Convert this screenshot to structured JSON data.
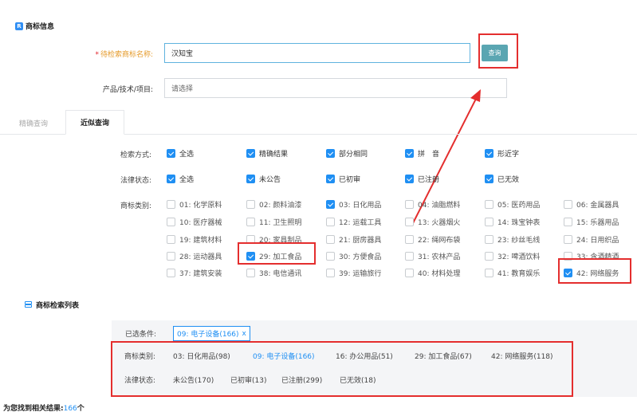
{
  "header": {
    "logo_letter": "R",
    "title": "商标信息"
  },
  "form": {
    "name_label": "待检索商标名称:",
    "name_value": "汉知宝",
    "query_button": "查询",
    "product_label": "产品/技术/项目:",
    "product_placeholder": "请选择"
  },
  "tabs": [
    {
      "label": "精确查询",
      "active": false
    },
    {
      "label": "近似查询",
      "active": true
    }
  ],
  "filters": {
    "method_label": "检索方式:",
    "method_options": [
      {
        "label": "全选",
        "checked": true
      },
      {
        "label": "精确结果",
        "checked": true
      },
      {
        "label": "部分相同",
        "checked": true
      },
      {
        "label": "拼　音",
        "checked": true
      },
      {
        "label": "形近字",
        "checked": true
      }
    ],
    "status_label": "法律状态:",
    "status_options": [
      {
        "label": "全选",
        "checked": true
      },
      {
        "label": "未公告",
        "checked": true
      },
      {
        "label": "已初审",
        "checked": true
      },
      {
        "label": "已注册",
        "checked": true
      },
      {
        "label": "已无效",
        "checked": true
      }
    ],
    "category_label": "商标类别:",
    "categories": [
      {
        "label": "01: 化学原料",
        "checked": false
      },
      {
        "label": "02: 颜料油漆",
        "checked": false
      },
      {
        "label": "03: 日化用品",
        "checked": true
      },
      {
        "label": "04: 油脂燃料",
        "checked": false
      },
      {
        "label": "05: 医药用品",
        "checked": false
      },
      {
        "label": "06: 金属器具",
        "checked": false
      },
      {
        "label": "10: 医疗器械",
        "checked": false
      },
      {
        "label": "11: 卫生照明",
        "checked": false
      },
      {
        "label": "12: 运载工具",
        "checked": false
      },
      {
        "label": "13: 火器烟火",
        "checked": false
      },
      {
        "label": "14: 珠宝钟表",
        "checked": false
      },
      {
        "label": "15: 乐器用品",
        "checked": false
      },
      {
        "label": "19: 建筑材料",
        "checked": false
      },
      {
        "label": "20: 家具制品",
        "checked": false
      },
      {
        "label": "21: 厨房器具",
        "checked": false
      },
      {
        "label": "22: 绳网布袋",
        "checked": false
      },
      {
        "label": "23: 纱丝毛线",
        "checked": false
      },
      {
        "label": "24: 日用织品",
        "checked": false
      },
      {
        "label": "28: 运动器具",
        "checked": false
      },
      {
        "label": "29: 加工食品",
        "checked": true
      },
      {
        "label": "30: 方便食品",
        "checked": false
      },
      {
        "label": "31: 农林产品",
        "checked": false
      },
      {
        "label": "32: 啤酒饮料",
        "checked": false
      },
      {
        "label": "33: 含酒精酒",
        "checked": false
      },
      {
        "label": "37: 建筑安装",
        "checked": false
      },
      {
        "label": "38: 电信通讯",
        "checked": false
      },
      {
        "label": "39: 运输旅行",
        "checked": false
      },
      {
        "label": "40: 材料处理",
        "checked": false
      },
      {
        "label": "41: 教育娱乐",
        "checked": false
      },
      {
        "label": "42: 网络服务",
        "checked": true
      }
    ]
  },
  "results": {
    "title": "商标检索列表",
    "selected_label": "已选条件:",
    "selected_chip": "09: 电子设备(166)",
    "selected_chip_close": "x",
    "category_label": "商标类别:",
    "category_summary": [
      {
        "label": "03: 日化用品(98)",
        "selected": false
      },
      {
        "label": "09: 电子设备(166)",
        "selected": true
      },
      {
        "label": "16: 办公用品(51)",
        "selected": false
      },
      {
        "label": "29: 加工食品(67)",
        "selected": false
      },
      {
        "label": "42: 网络服务(118)",
        "selected": false
      }
    ],
    "status_label": "法律状态:",
    "status_summary": [
      {
        "label": "未公告(170)"
      },
      {
        "label": "已初审(13)"
      },
      {
        "label": "已注册(299)"
      },
      {
        "label": "已无效(18)"
      }
    ],
    "found_prefix": "为您找到相关结果:",
    "found_count": "166",
    "found_suffix": "个"
  },
  "colors": {
    "accent": "#1f8ff3",
    "annotation": "#e42e2e",
    "button": "#5aa6b2"
  }
}
